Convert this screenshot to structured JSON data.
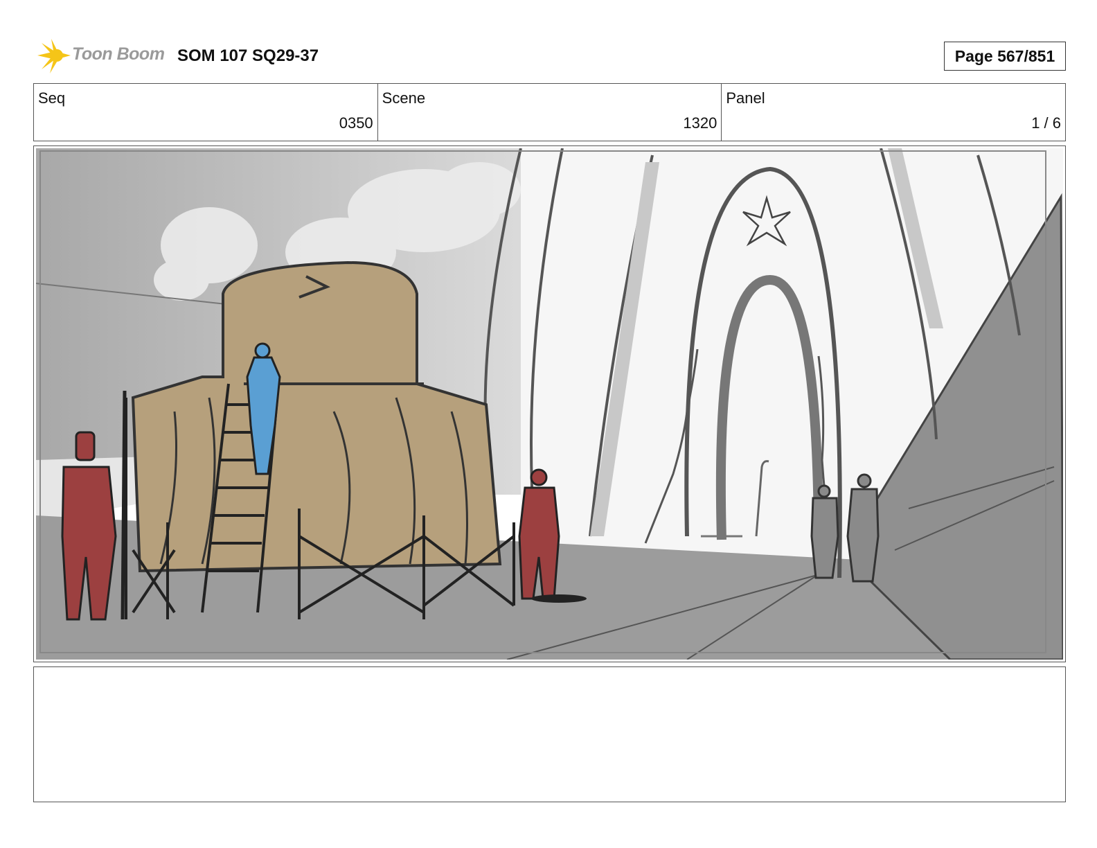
{
  "header": {
    "logo_text": "Toon Boom",
    "logo_color": "#f5c518",
    "document_title": "SOM 107 SQ29-37",
    "page_label": "Page 567/851"
  },
  "info": {
    "seq_label": "Seq",
    "seq_value": "0350",
    "scene_label": "Scene",
    "scene_value": "1320",
    "panel_label": "Panel",
    "panel_value": "1 / 6"
  },
  "panel": {
    "image_icon": "storyboard-sketch",
    "palette": {
      "tent": "#b6a07c",
      "guard": "#9c4040",
      "climber": "#5a9fd3",
      "ground": "#9a9a9a",
      "wall": "#8f8f8f",
      "sky": "#b8b8b8"
    }
  },
  "notes": {
    "text": ""
  }
}
